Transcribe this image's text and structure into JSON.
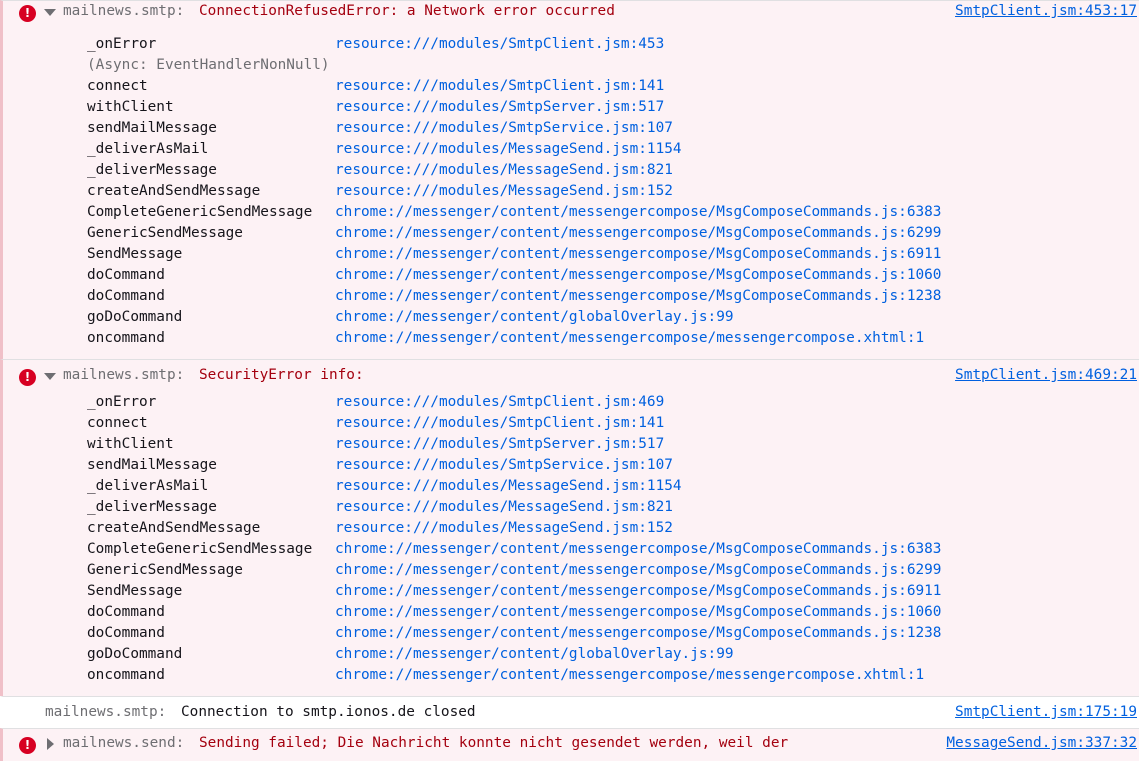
{
  "messages": [
    {
      "level": "error",
      "prefix": "mailnews.smtp:",
      "text": "ConnectionRefusedError: a Network error occurred",
      "source": "SmtpClient.jsm:453:17",
      "expanded": true,
      "frames": [
        {
          "fn": "_onError",
          "loc": "resource:///modules/SmtpClient.jsm:453"
        },
        {
          "fn": "(Async: EventHandlerNonNull)",
          "loc": ""
        },
        {
          "fn": "connect",
          "loc": "resource:///modules/SmtpClient.jsm:141"
        },
        {
          "fn": "withClient",
          "loc": "resource:///modules/SmtpServer.jsm:517"
        },
        {
          "fn": "sendMailMessage",
          "loc": "resource:///modules/SmtpService.jsm:107"
        },
        {
          "fn": "_deliverAsMail",
          "loc": "resource:///modules/MessageSend.jsm:1154"
        },
        {
          "fn": "_deliverMessage",
          "loc": "resource:///modules/MessageSend.jsm:821"
        },
        {
          "fn": "createAndSendMessage",
          "loc": "resource:///modules/MessageSend.jsm:152"
        },
        {
          "fn": "CompleteGenericSendMessage",
          "loc": "chrome://messenger/content/messengercompose/MsgComposeCommands.js:6383"
        },
        {
          "fn": "GenericSendMessage",
          "loc": "chrome://messenger/content/messengercompose/MsgComposeCommands.js:6299"
        },
        {
          "fn": "SendMessage",
          "loc": "chrome://messenger/content/messengercompose/MsgComposeCommands.js:6911"
        },
        {
          "fn": "doCommand",
          "loc": "chrome://messenger/content/messengercompose/MsgComposeCommands.js:1060"
        },
        {
          "fn": "doCommand",
          "loc": "chrome://messenger/content/messengercompose/MsgComposeCommands.js:1238"
        },
        {
          "fn": "goDoCommand",
          "loc": "chrome://messenger/content/globalOverlay.js:99"
        },
        {
          "fn": "oncommand",
          "loc": "chrome://messenger/content/messengercompose/messengercompose.xhtml:1"
        }
      ]
    },
    {
      "level": "error",
      "prefix": "mailnews.smtp:",
      "text": "SecurityError info:",
      "source": "SmtpClient.jsm:469:21",
      "expanded": true,
      "frames": [
        {
          "fn": "_onError",
          "loc": "resource:///modules/SmtpClient.jsm:469"
        },
        {
          "fn": "connect",
          "loc": "resource:///modules/SmtpClient.jsm:141"
        },
        {
          "fn": "withClient",
          "loc": "resource:///modules/SmtpServer.jsm:517"
        },
        {
          "fn": "sendMailMessage",
          "loc": "resource:///modules/SmtpService.jsm:107"
        },
        {
          "fn": "_deliverAsMail",
          "loc": "resource:///modules/MessageSend.jsm:1154"
        },
        {
          "fn": "_deliverMessage",
          "loc": "resource:///modules/MessageSend.jsm:821"
        },
        {
          "fn": "createAndSendMessage",
          "loc": "resource:///modules/MessageSend.jsm:152"
        },
        {
          "fn": "CompleteGenericSendMessage",
          "loc": "chrome://messenger/content/messengercompose/MsgComposeCommands.js:6383"
        },
        {
          "fn": "GenericSendMessage",
          "loc": "chrome://messenger/content/messengercompose/MsgComposeCommands.js:6299"
        },
        {
          "fn": "SendMessage",
          "loc": "chrome://messenger/content/messengercompose/MsgComposeCommands.js:6911"
        },
        {
          "fn": "doCommand",
          "loc": "chrome://messenger/content/messengercompose/MsgComposeCommands.js:1060"
        },
        {
          "fn": "doCommand",
          "loc": "chrome://messenger/content/messengercompose/MsgComposeCommands.js:1238"
        },
        {
          "fn": "goDoCommand",
          "loc": "chrome://messenger/content/globalOverlay.js:99"
        },
        {
          "fn": "oncommand",
          "loc": "chrome://messenger/content/messengercompose/messengercompose.xhtml:1"
        }
      ]
    },
    {
      "level": "log",
      "prefix": "mailnews.smtp:",
      "text": "Connection to smtp.ionos.de closed",
      "source": "SmtpClient.jsm:175:19",
      "expanded": false,
      "frames": []
    },
    {
      "level": "error",
      "prefix": "mailnews.send:",
      "text": "Sending failed; Die Nachricht konnte nicht gesendet werden, weil der",
      "source": "MessageSend.jsm:337:32",
      "expanded": false,
      "frames": []
    }
  ],
  "icons": {
    "error": "error-icon",
    "twisty_open": "chevron-down-icon",
    "twisty_closed": "chevron-right-icon"
  },
  "colors": {
    "error_bg": "#fdf2f5",
    "error_text": "#a4000f",
    "link": "#0060df",
    "error_icon": "#d70022"
  }
}
